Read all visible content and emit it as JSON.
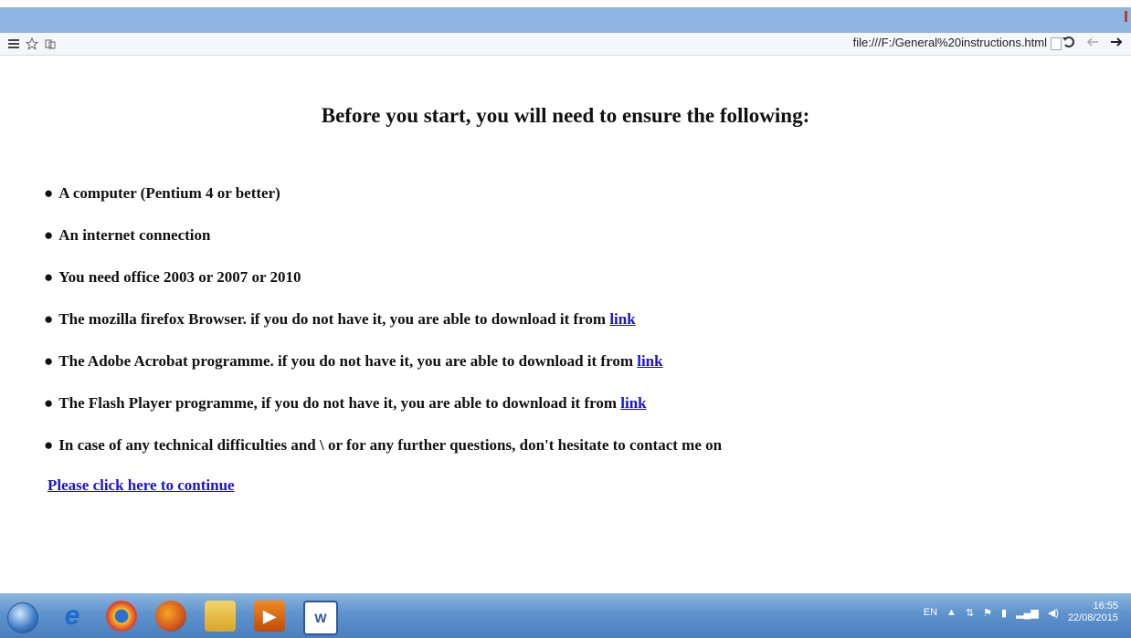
{
  "browser": {
    "url": "file:///F:/General%20instructions.html",
    "icons": [
      "menu-icon",
      "star-icon",
      "pages-icon",
      "page-icon",
      "reload-icon",
      "back-icon",
      "forward-icon"
    ]
  },
  "page": {
    "heading": "Before you start, you will need to ensure the following:",
    "items": [
      {
        "text": "A computer (Pentium 4 or better)",
        "link": ""
      },
      {
        "text": "An internet connection",
        "link": ""
      },
      {
        "text": "You need office 2003 or 2007 or 2010",
        "link": ""
      },
      {
        "text": "The mozilla firefox Browser. if you do not have it, you are able to download it from",
        "link": "link"
      },
      {
        "text": "The Adobe Acrobat programme. if you do not have it, you are able to download it from",
        "link": "link"
      },
      {
        "text": "The Flash Player programme, if you do not have it, you are able to download it from",
        "link": "link"
      },
      {
        "text": "In case of any technical difficulties and \\ or for any further questions, don't hesitate to contact me on",
        "link": ""
      }
    ],
    "bullet": "●",
    "continue_link": "Please click here to continue"
  },
  "taskbar": {
    "apps": [
      "internet-explorer",
      "chrome",
      "firefox",
      "file-explorer",
      "media-player",
      "word"
    ],
    "tray": {
      "language": "EN",
      "time": "16:55",
      "date": "22/08/2015"
    }
  },
  "colors": {
    "link": "#1a12d6",
    "titlebar": "#8fb5e2",
    "taskbar": "#5f93cc"
  }
}
